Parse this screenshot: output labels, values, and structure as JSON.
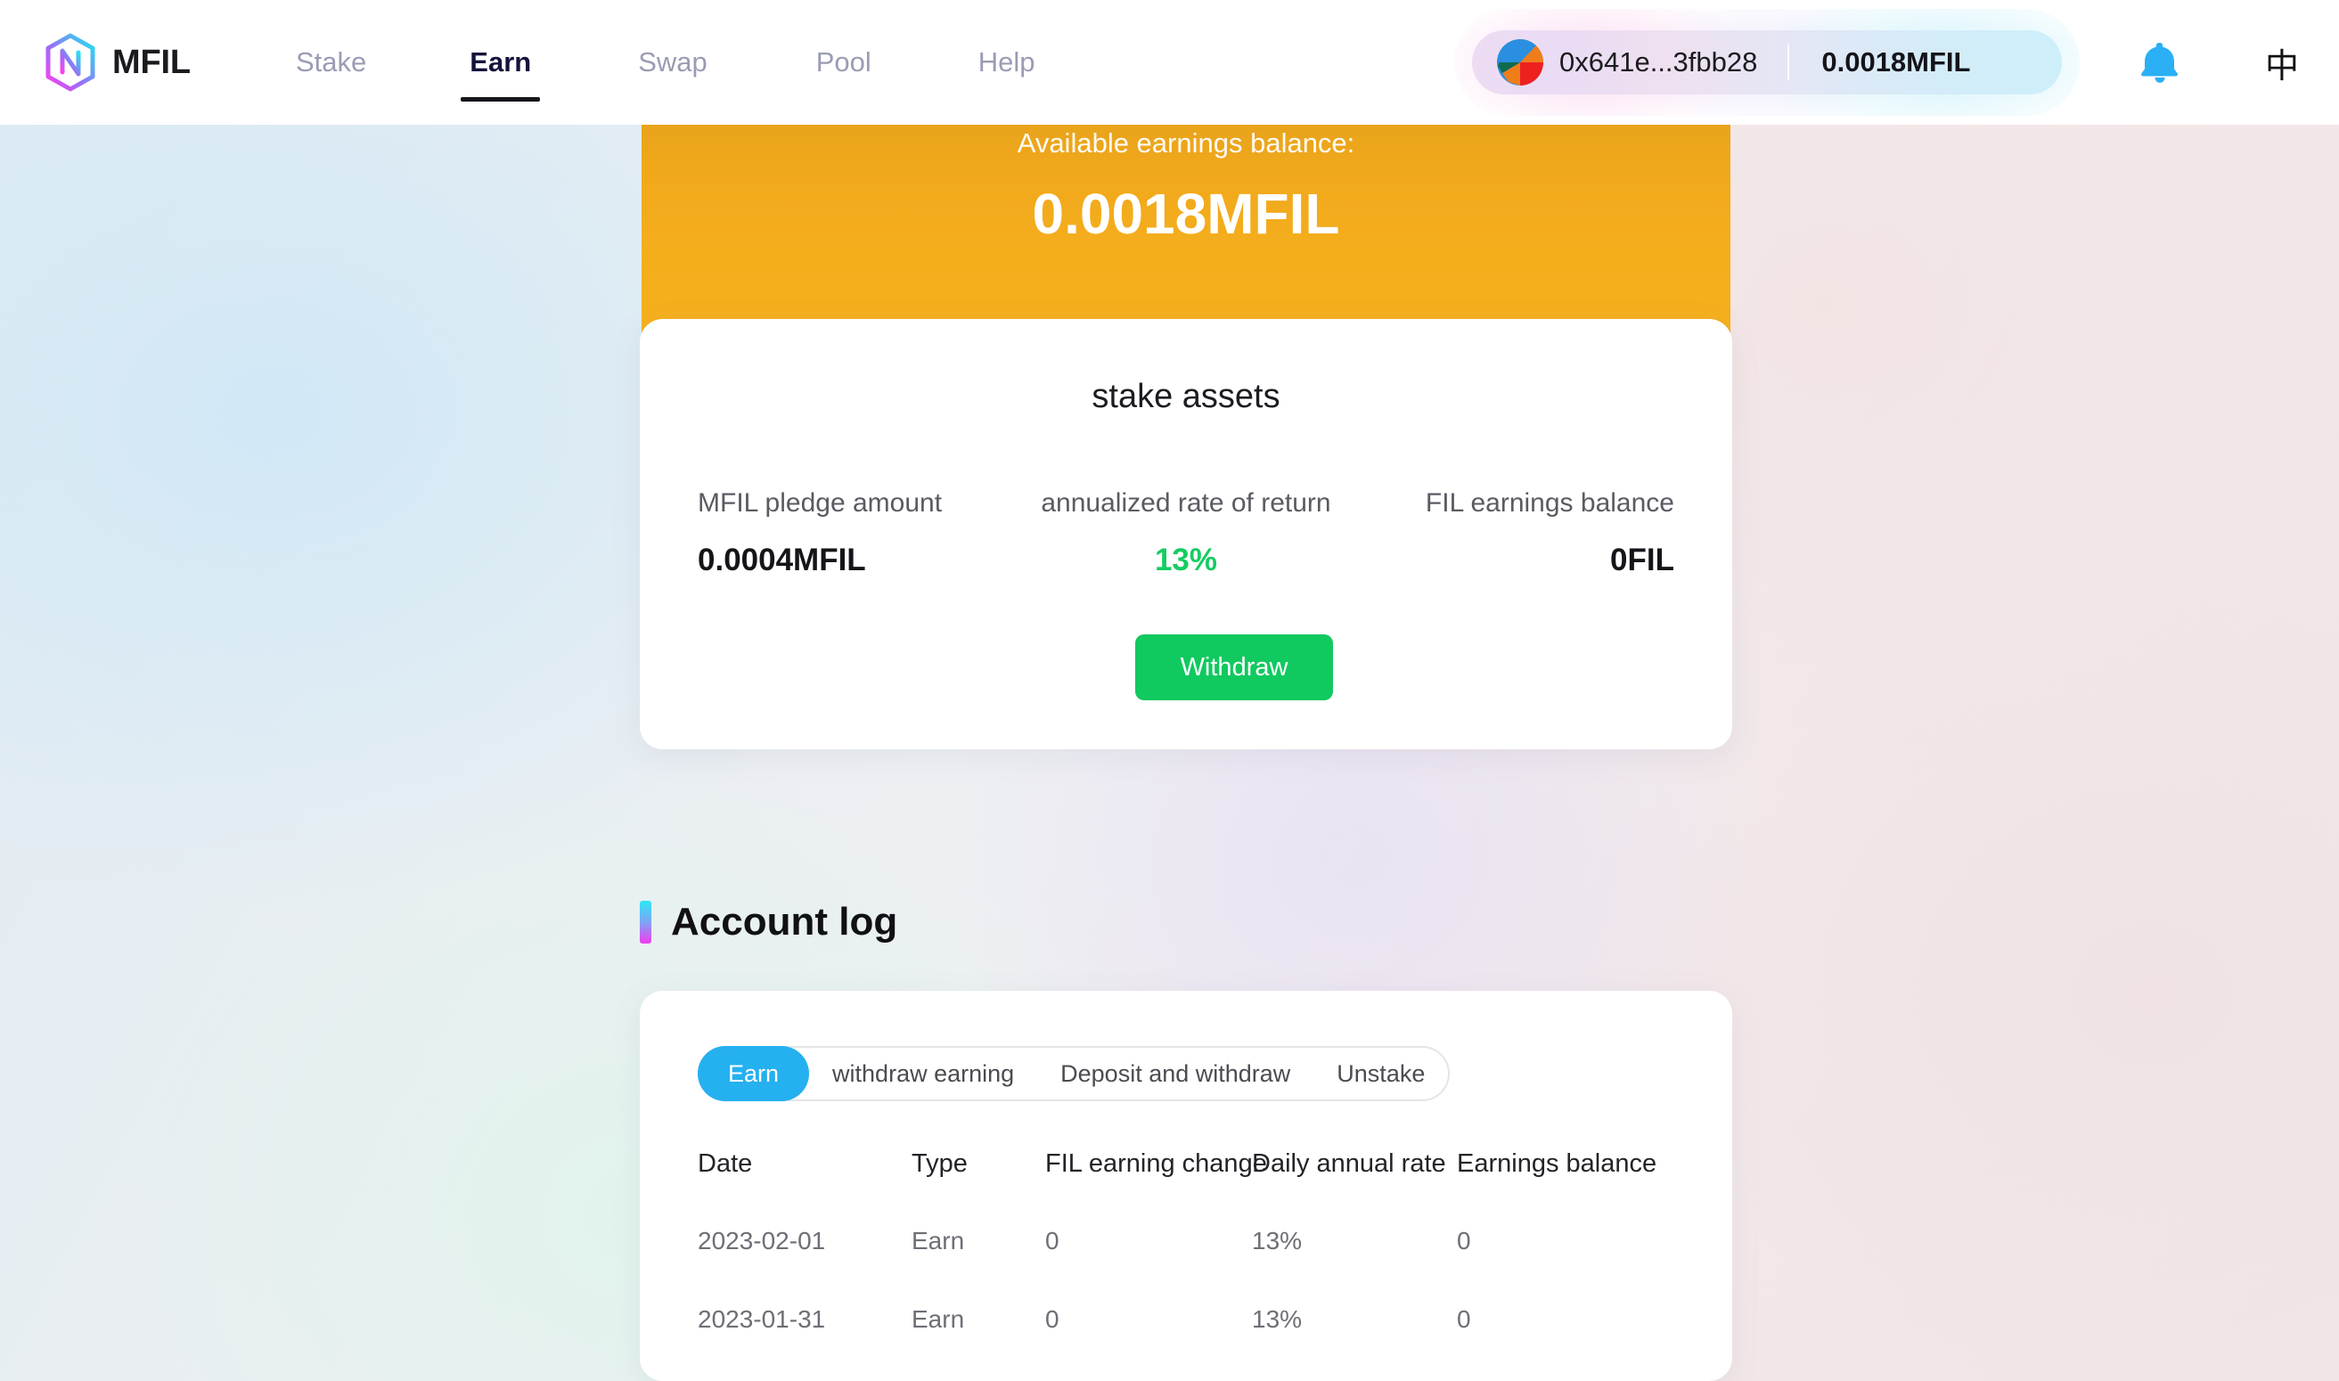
{
  "brand": {
    "name": "MFIL",
    "logo_icon": "hexagon-logo-icon",
    "logo_gradient_from": "#ff3df0",
    "logo_gradient_to": "#1fe6f0"
  },
  "nav": {
    "items": [
      {
        "label": "Stake",
        "active": false
      },
      {
        "label": "Earn",
        "active": true
      },
      {
        "label": "Swap",
        "active": false
      },
      {
        "label": "Pool",
        "active": false
      },
      {
        "label": "Help",
        "active": false
      }
    ]
  },
  "header_actions": {
    "wallet": {
      "avatar_icon": "wallet-blockie-avatar",
      "address": "0x641e...3fbb28",
      "balance": "0.0018MFIL"
    },
    "notification_icon": "bell-icon",
    "notification_color": "#2bb0f5",
    "language_label": "中",
    "language_icon": "language-toggle-icon"
  },
  "banner": {
    "label": "Available earnings balance:",
    "value": "0.0018MFIL",
    "color": "#f4ad1c"
  },
  "stake_card": {
    "title": "stake assets",
    "metrics": [
      {
        "label": "MFIL pledge amount",
        "value": "0.0004MFIL",
        "align": "left",
        "color": "#141419"
      },
      {
        "label": "annualized rate of return",
        "value": "13%",
        "align": "center",
        "color": "#15cc62"
      },
      {
        "label": "FIL earnings balance",
        "value": "0FIL",
        "align": "right",
        "color": "#141419"
      }
    ],
    "withdraw_label": "Withdraw",
    "withdraw_color": "#10c95f"
  },
  "account_log": {
    "title": "Account log",
    "accent_from": "#2ee6f7",
    "accent_to": "#f03cf0",
    "tabs": [
      {
        "label": "Earn",
        "active": true
      },
      {
        "label": "withdraw earning",
        "active": false
      },
      {
        "label": "Deposit and withdraw",
        "active": false
      },
      {
        "label": "Unstake",
        "active": false
      }
    ],
    "active_tab_color": "#25b0f0",
    "table": {
      "columns": [
        "Date",
        "Type",
        "FIL earning change",
        "Daily annual rate",
        "Earnings balance"
      ],
      "rows": [
        {
          "date": "2023-02-01",
          "type": "Earn",
          "change": "0",
          "rate": "13%",
          "balance": "0"
        },
        {
          "date": "2023-01-31",
          "type": "Earn",
          "change": "0",
          "rate": "13%",
          "balance": "0"
        }
      ]
    }
  }
}
